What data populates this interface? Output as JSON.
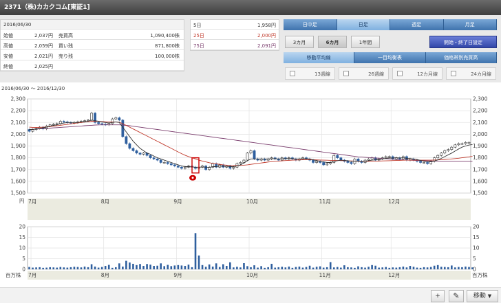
{
  "header": {
    "title": "2371（株)カカクコム[東証1]"
  },
  "quote": {
    "date": "2016/06/30",
    "rows": [
      {
        "label": "始値",
        "value": "2,037円",
        "label2": "売買高",
        "value2": "1,090,400株"
      },
      {
        "label": "高値",
        "value": "2,059円",
        "label2": "買い残",
        "value2": "871,800株"
      },
      {
        "label": "安値",
        "value": "2,021円",
        "label2": "売り残",
        "value2": "100,000株"
      },
      {
        "label": "終値",
        "value": "2,025円",
        "label2": "",
        "value2": ""
      }
    ]
  },
  "ma_panel": [
    {
      "label": "5日",
      "value": "1,958円",
      "color": "#333333"
    },
    {
      "label": "25日",
      "value": "2,000円",
      "color": "#c0392b"
    },
    {
      "label": "75日",
      "value": "2,091円",
      "color": "#7a3d6d"
    }
  ],
  "controls": {
    "period_tabs": [
      {
        "label": "日中足",
        "active": false
      },
      {
        "label": "日足",
        "active": true
      },
      {
        "label": "週足",
        "active": false
      },
      {
        "label": "月足",
        "active": false
      }
    ],
    "range_buttons": [
      {
        "label": "3カ月",
        "active": false
      },
      {
        "label": "6カ月",
        "active": true
      },
      {
        "label": "1年間",
        "active": false
      }
    ],
    "setting_button": "開始・終了日設定",
    "indicator_tabs": [
      {
        "label": "移動平均線",
        "active": true
      },
      {
        "label": "一目均衡表",
        "active": false
      },
      {
        "label": "価格帯別売買高",
        "active": false
      }
    ],
    "ma_checks": [
      "13週線",
      "26週線",
      "12カ月線",
      "24カ月線"
    ]
  },
  "period_label": "2016/06/30 〜 2016/12/30",
  "toolbar": {
    "plus": "+",
    "move": "移動",
    "dropdown": "▼"
  },
  "chart_data": [
    {
      "type": "candlestick",
      "ylim": [
        1500,
        2300
      ],
      "yticks": [
        1500,
        1600,
        1700,
        1800,
        1900,
        2000,
        2100,
        2200,
        2300
      ],
      "ytick_labels": [
        "1,500",
        "1,600",
        "1,700",
        "1,800",
        "1,900",
        "2,000",
        "2,100",
        "2,200",
        "2,300"
      ],
      "yunit": "円",
      "month_labels": [
        "7月",
        "8月",
        "9月",
        "10月",
        "11月",
        "12月"
      ],
      "month_starts": [
        1,
        22,
        43,
        64,
        85,
        105
      ],
      "n_days": 128,
      "close": [
        2025,
        2040,
        2050,
        2060,
        2045,
        2070,
        2080,
        2085,
        2090,
        2110,
        2105,
        2100,
        2095,
        2100,
        2105,
        2110,
        2115,
        2120,
        2180,
        2100,
        2090,
        2085,
        2080,
        2090,
        2130,
        2140,
        2120,
        1980,
        1920,
        1880,
        1860,
        1840,
        1830,
        1840,
        1820,
        1800,
        1790,
        1780,
        1760,
        1760,
        1750,
        1740,
        1730,
        1720,
        1710,
        1720,
        1730,
        1720,
        1710,
        1720,
        1730,
        1700,
        1720,
        1750,
        1720,
        1740,
        1720,
        1730,
        1710,
        1720,
        1750,
        1760,
        1780,
        1840,
        1860,
        1790,
        1780,
        1790,
        1780,
        1790,
        1800,
        1790,
        1780,
        1800,
        1790,
        1800,
        1790,
        1780,
        1790,
        1800,
        1790,
        1780,
        1760,
        1770,
        1760,
        1740,
        1750,
        1760,
        1820,
        1800,
        1780,
        1770,
        1760,
        1750,
        1790,
        1770,
        1760,
        1780,
        1790,
        1800,
        1780,
        1790,
        1800,
        1810,
        1810,
        1790,
        1800,
        1790,
        1810,
        1780,
        1790,
        1780,
        1770,
        1760,
        1760,
        1750,
        1770,
        1800,
        1820,
        1840,
        1860,
        1870,
        1890,
        1910,
        1920,
        1920,
        1930,
        1930,
        1920
      ],
      "ma_short": [
        2040,
        2040,
        2045,
        2050,
        2055,
        2060,
        2070,
        2075,
        2080,
        2090,
        2095,
        2100,
        2100,
        2100,
        2100,
        2105,
        2105,
        2110,
        2120,
        2115,
        2110,
        2105,
        2100,
        2095,
        2100,
        2105,
        2100,
        2060,
        2020,
        1980,
        1940,
        1910,
        1880,
        1860,
        1840,
        1830,
        1815,
        1800,
        1790,
        1780,
        1770,
        1760,
        1750,
        1740,
        1730,
        1725,
        1725,
        1722,
        1720,
        1720,
        1722,
        1720,
        1718,
        1725,
        1725,
        1730,
        1728,
        1728,
        1725,
        1725,
        1730,
        1740,
        1755,
        1775,
        1790,
        1790,
        1790,
        1790,
        1790,
        1790,
        1792,
        1792,
        1790,
        1792,
        1792,
        1794,
        1792,
        1790,
        1790,
        1792,
        1792,
        1790,
        1782,
        1776,
        1770,
        1765,
        1760,
        1760,
        1770,
        1775,
        1780,
        1778,
        1775,
        1770,
        1772,
        1770,
        1768,
        1770,
        1775,
        1780,
        1782,
        1785,
        1790,
        1795,
        1798,
        1798,
        1800,
        1798,
        1800,
        1795,
        1793,
        1790,
        1785,
        1778,
        1772,
        1765,
        1765,
        1772,
        1782,
        1795,
        1810,
        1825,
        1840,
        1858,
        1875,
        1890,
        1900,
        1908,
        1912
      ],
      "ma_mid": [
        2060,
        2058,
        2058,
        2058,
        2060,
        2062,
        2065,
        2068,
        2072,
        2076,
        2080,
        2084,
        2088,
        2092,
        2096,
        2100,
        2103,
        2106,
        2110,
        2110,
        2110,
        2108,
        2106,
        2104,
        2104,
        2104,
        2102,
        2090,
        2075,
        2060,
        2045,
        2030,
        2015,
        2000,
        1985,
        1970,
        1955,
        1940,
        1925,
        1910,
        1895,
        1880,
        1865,
        1850,
        1835,
        1822,
        1810,
        1800,
        1790,
        1780,
        1772,
        1765,
        1758,
        1752,
        1748,
        1744,
        1740,
        1737,
        1735,
        1734,
        1734,
        1735,
        1737,
        1740,
        1744,
        1748,
        1752,
        1756,
        1760,
        1764,
        1767,
        1770,
        1772,
        1774,
        1776,
        1778,
        1780,
        1781,
        1782,
        1783,
        1784,
        1784,
        1783,
        1782,
        1781,
        1780,
        1779,
        1778,
        1778,
        1777,
        1776,
        1775,
        1774,
        1773,
        1772,
        1771,
        1770,
        1770,
        1770,
        1770,
        1771,
        1772,
        1773,
        1774,
        1775,
        1776,
        1777,
        1778,
        1779,
        1780,
        1780,
        1780,
        1780,
        1780,
        1780,
        1780,
        1780,
        1781,
        1782,
        1784,
        1786,
        1788,
        1790,
        1793,
        1796,
        1800,
        1804,
        1808,
        1812
      ],
      "ma_long": [
        2040,
        2042,
        2044,
        2046,
        2048,
        2050,
        2052,
        2054,
        2056,
        2058,
        2060,
        2062,
        2064,
        2066,
        2068,
        2070,
        2072,
        2074,
        2076,
        2078,
        2079,
        2080,
        2080,
        2080,
        2080,
        2080,
        2080,
        2078,
        2075,
        2072,
        2068,
        2064,
        2060,
        2056,
        2052,
        2048,
        2044,
        2040,
        2036,
        2032,
        2028,
        2024,
        2020,
        2016,
        2012,
        2008,
        2004,
        2000,
        1996,
        1992,
        1988,
        1984,
        1980,
        1976,
        1972,
        1968,
        1964,
        1960,
        1956,
        1952,
        1948,
        1944,
        1940,
        1936,
        1932,
        1928,
        1924,
        1920,
        1916,
        1912,
        1908,
        1904,
        1900,
        1896,
        1892,
        1888,
        1884,
        1880,
        1876,
        1872,
        1868,
        1864,
        1860,
        1856,
        1852,
        1848,
        1844,
        1840,
        1836,
        1832,
        1828,
        1824,
        1820,
        1816,
        1812,
        1808,
        1806,
        1804,
        1802,
        1800,
        1798,
        1796,
        1794,
        1792,
        1790,
        1788,
        1786,
        1784,
        1782,
        1780,
        1779,
        1778,
        1777,
        1776,
        1775,
        1774,
        1773,
        1772,
        1771,
        1770,
        1770,
        1770,
        1770,
        1770,
        1770,
        1770,
        1770,
        1770,
        1770
      ],
      "series_colors": {
        "up": "#ffffff",
        "down": "#2f5f9e",
        "ma_short": "#333333",
        "ma_mid": "#c0392b",
        "ma_long": "#7a3d6d"
      }
    },
    {
      "type": "bar",
      "ylim": [
        0,
        20
      ],
      "yticks": [
        0,
        5,
        10,
        15,
        20
      ],
      "ytick_labels": [
        "0",
        "5",
        "10",
        "15",
        "20"
      ],
      "yunit": "百万株",
      "volume": [
        1.1,
        0.8,
        0.9,
        1.0,
        0.7,
        0.8,
        1.0,
        0.9,
        0.8,
        1.1,
        0.9,
        0.8,
        1.0,
        1.2,
        1.1,
        0.9,
        1.3,
        1.0,
        2.4,
        1.3,
        0.8,
        1.1,
        1.6,
        2.1,
        0.7,
        1.0,
        2.8,
        1.3,
        4.0,
        3.2,
        2.6,
        2.0,
        2.5,
        1.6,
        2.5,
        2.2,
        1.6,
        1.7,
        2.8,
        1.5,
        2.1,
        1.5,
        1.8,
        2.0,
        1.8,
        1.6,
        2.2,
        1.0,
        17.0,
        6.5,
        2.0,
        1.2,
        2.3,
        1.3,
        2.8,
        1.1,
        2.4,
        1.6,
        3.3,
        0.9,
        1.2,
        0.9,
        2.9,
        1.5,
        1.0,
        1.9,
        0.8,
        1.5,
        0.7,
        1.0,
        2.6,
        0.8,
        1.0,
        1.2,
        0.9,
        1.3,
        0.7,
        1.1,
        1.3,
        0.8,
        1.1,
        1.7,
        0.8,
        1.2,
        1.4,
        0.8,
        1.0,
        3.4,
        0.9,
        1.1,
        0.8,
        1.9,
        1.0,
        0.9,
        0.7,
        1.4,
        1.0,
        0.8,
        1.2,
        2.0,
        1.7,
        0.8,
        0.9,
        1.1,
        0.7,
        0.9,
        0.8,
        1.0,
        1.3,
        0.9,
        1.6,
        1.2,
        0.8,
        0.7,
        1.0,
        0.9,
        1.1,
        1.7,
        2.0,
        1.2,
        1.1,
        1.0,
        1.8,
        0.9,
        1.1,
        1.0,
        1.3,
        1.1,
        0.9
      ]
    }
  ]
}
